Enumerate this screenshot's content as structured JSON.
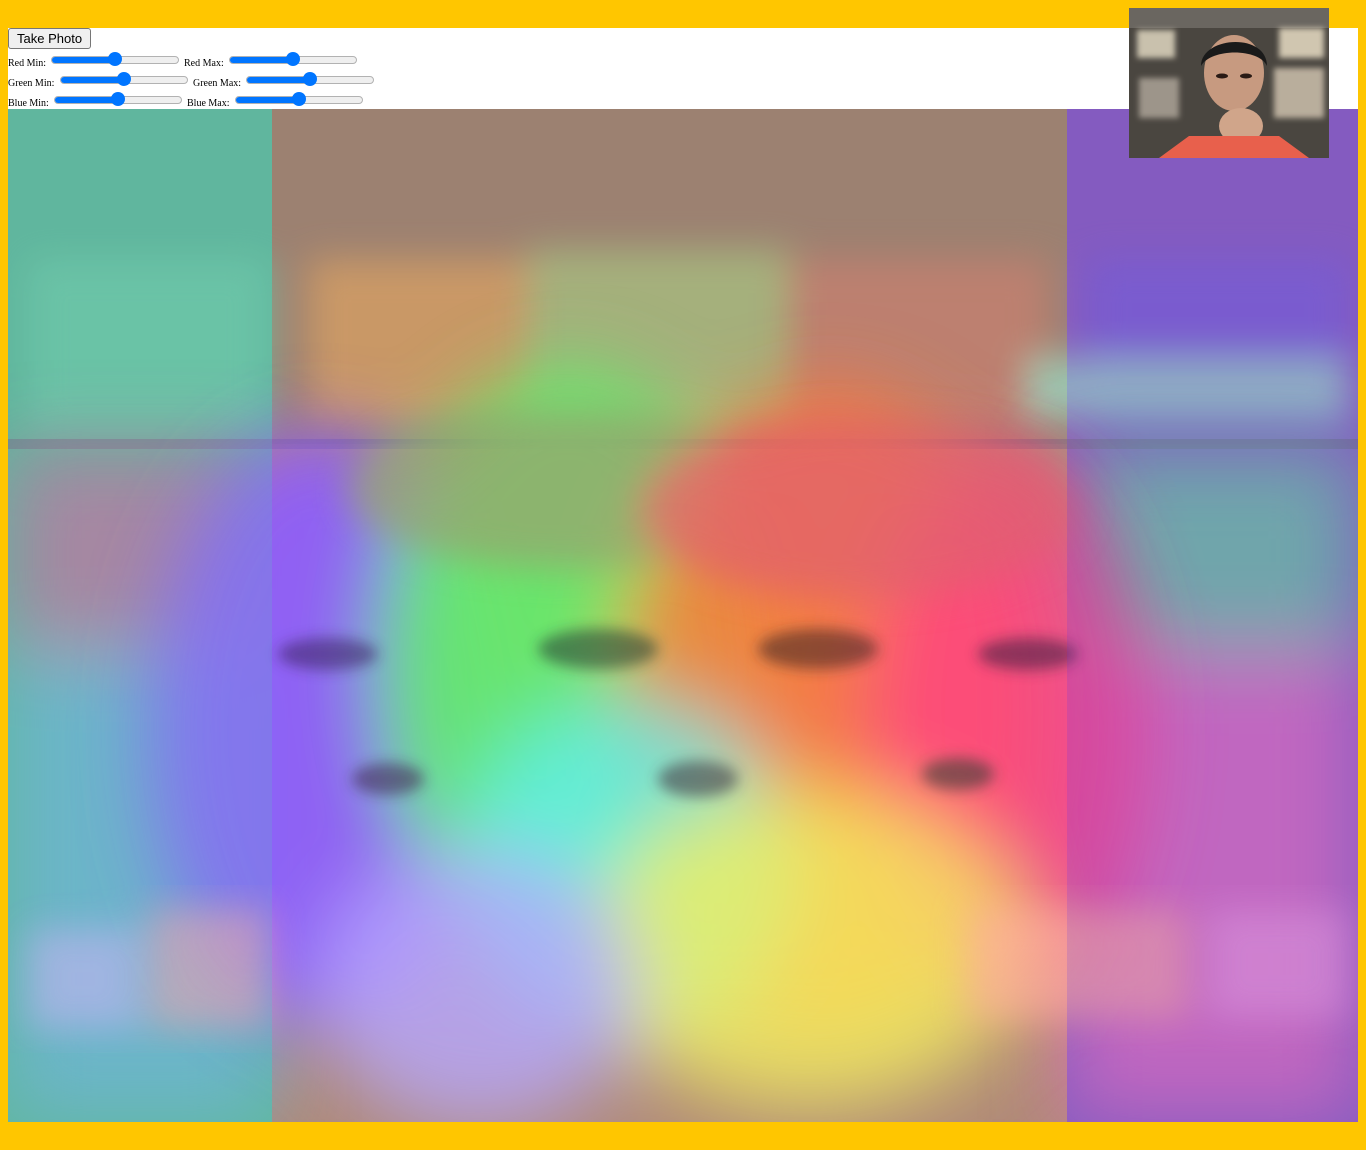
{
  "take_photo_label": "Take Photo",
  "sliders": [
    {
      "label": "Red Min:",
      "value": 0.5
    },
    {
      "label": "Red Max:",
      "value": 0.5
    },
    {
      "label": "Green Min:",
      "value": 0.5
    },
    {
      "label": "Green Max:",
      "value": 0.5
    },
    {
      "label": "Blue Min:",
      "value": 0.5
    },
    {
      "label": "Blue Max:",
      "value": 0.5
    }
  ],
  "colors": {
    "page_background": "#ffc600",
    "accent": "#0075ff"
  }
}
